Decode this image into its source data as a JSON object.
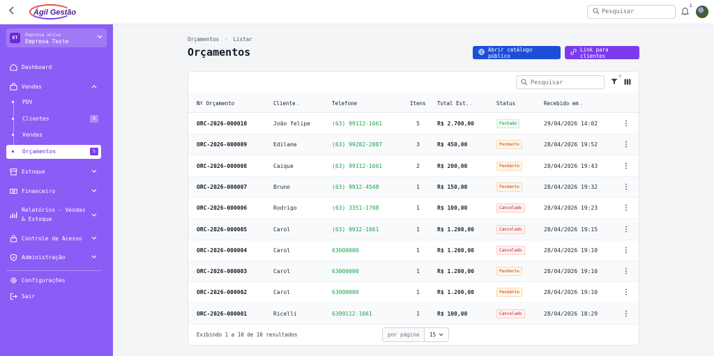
{
  "header": {
    "logo_text": "Ágil Gestão",
    "search_placeholder": "Pesquisar",
    "notifications_count": "1"
  },
  "sidebar": {
    "company_label": "Empresa ativa",
    "company_name": "Empresa Teste",
    "company_initials": "ET",
    "items": [
      {
        "label": "Dashboard"
      },
      {
        "label": "Vendas"
      },
      {
        "label": "Estoque"
      },
      {
        "label": "Financeiro"
      },
      {
        "label": "Relatórios - Vendas & Estoque"
      },
      {
        "label": "Controle de Acesso"
      },
      {
        "label": "Administração"
      },
      {
        "label": "Configurações"
      },
      {
        "label": "Sair"
      }
    ],
    "vendas_sub": [
      {
        "label": "PDV",
        "count": ""
      },
      {
        "label": "Clientes",
        "count": "8"
      },
      {
        "label": "Vendas",
        "count": ""
      },
      {
        "label": "Orçamentos",
        "count": "5"
      }
    ]
  },
  "breadcrumb": [
    "Orçamentos",
    "Listar"
  ],
  "page_title": "Orçamentos",
  "buttons": {
    "catalog": "Abrir catálogo público",
    "link": "Link para clientes"
  },
  "table": {
    "search_placeholder": "Pesquisar",
    "filter_count": "0",
    "columns": [
      "Nº Orçamento",
      "Cliente",
      "Telefone",
      "Itens",
      "Total Est.",
      "Status",
      "Recebido em"
    ],
    "rows": [
      {
        "num": "ORC-2026-000010",
        "cliente": "João felipe",
        "tel": "(63) 99112-1661",
        "itens": "5",
        "total": "R$ 2.700,00",
        "status": "Fechado",
        "st": "fechado",
        "recebido": "29/04/2026 14:02"
      },
      {
        "num": "ORC-2026-000009",
        "cliente": "Edilane",
        "tel": "(63) 99282-2087",
        "itens": "3",
        "total": "R$ 450,00",
        "status": "Pendente",
        "st": "pendente",
        "recebido": "28/04/2026 19:52"
      },
      {
        "num": "ORC-2026-000008",
        "cliente": "Caique",
        "tel": "(63) 99112-1661",
        "itens": "2",
        "total": "R$ 200,00",
        "status": "Pendente",
        "st": "pendente",
        "recebido": "28/04/2026 19:43"
      },
      {
        "num": "ORC-2026-000007",
        "cliente": "Bruno",
        "tel": "(63) 9912-4548",
        "itens": "1",
        "total": "R$ 150,00",
        "status": "Pendente",
        "st": "pendente",
        "recebido": "28/04/2026 19:32"
      },
      {
        "num": "ORC-2026-000006",
        "cliente": "Rodrigo",
        "tel": "(63) 3351-1708",
        "itens": "1",
        "total": "R$ 100,00",
        "status": "Cancelado",
        "st": "cancelado",
        "recebido": "28/04/2026 19:23"
      },
      {
        "num": "ORC-2026-000005",
        "cliente": "Carol",
        "tel": "(63) 9912-1661",
        "itens": "1",
        "total": "R$ 1.200,00",
        "status": "Cancelado",
        "st": "cancelado",
        "recebido": "28/04/2026 19:15"
      },
      {
        "num": "ORC-2026-000004",
        "cliente": "Carol",
        "tel": "63000000",
        "itens": "1",
        "total": "R$ 1.200,00",
        "status": "Cancelado",
        "st": "cancelado",
        "recebido": "28/04/2026 19:10"
      },
      {
        "num": "ORC-2026-000003",
        "cliente": "Carol",
        "tel": "63000000",
        "itens": "1",
        "total": "R$ 1.200,00",
        "status": "Pendente",
        "st": "pendente",
        "recebido": "28/04/2026 19:10"
      },
      {
        "num": "ORC-2026-000002",
        "cliente": "Carol",
        "tel": "63000000",
        "itens": "1",
        "total": "R$ 1.200,00",
        "status": "Pendente",
        "st": "pendente",
        "recebido": "28/04/2026 19:10"
      },
      {
        "num": "ORC-2026-000001",
        "cliente": "Ricelli",
        "tel": "6399112-1661",
        "itens": "1",
        "total": "R$ 100,00",
        "status": "Cancelado",
        "st": "cancelado",
        "recebido": "28/04/2026 18:29"
      }
    ],
    "footer": "Exibindo 1 a 10 de 10 resultados",
    "per_page_label": "por página",
    "per_page_value": "15"
  },
  "colors": {
    "sidebar": "#8b5cf6",
    "primary_blue": "#1d4ed8",
    "primary_purple": "#7c3aed",
    "phone_green": "#16a34a"
  }
}
